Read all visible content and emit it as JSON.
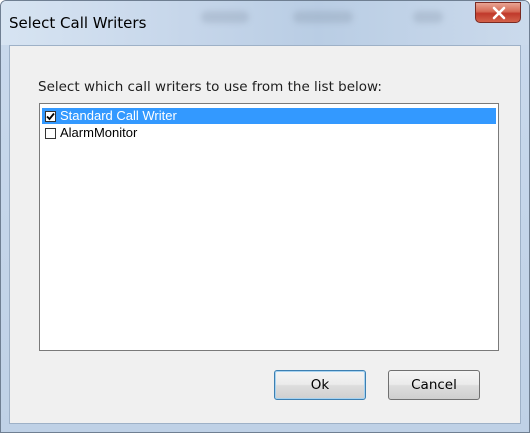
{
  "window": {
    "title": "Select Call Writers"
  },
  "dialog": {
    "instruction": "Select which call writers to use from the list below:",
    "items": [
      {
        "label": "Standard Call Writer",
        "checked": true,
        "selected": true
      },
      {
        "label": "AlarmMonitor",
        "checked": false,
        "selected": false
      }
    ],
    "ok_label": "Ok",
    "cancel_label": "Cancel"
  },
  "colors": {
    "selection": "#3399ff",
    "close_button": "#c0392b",
    "frame": "#c9d9ec"
  },
  "icons": {
    "close": "close-icon",
    "check": "checkmark-icon"
  }
}
